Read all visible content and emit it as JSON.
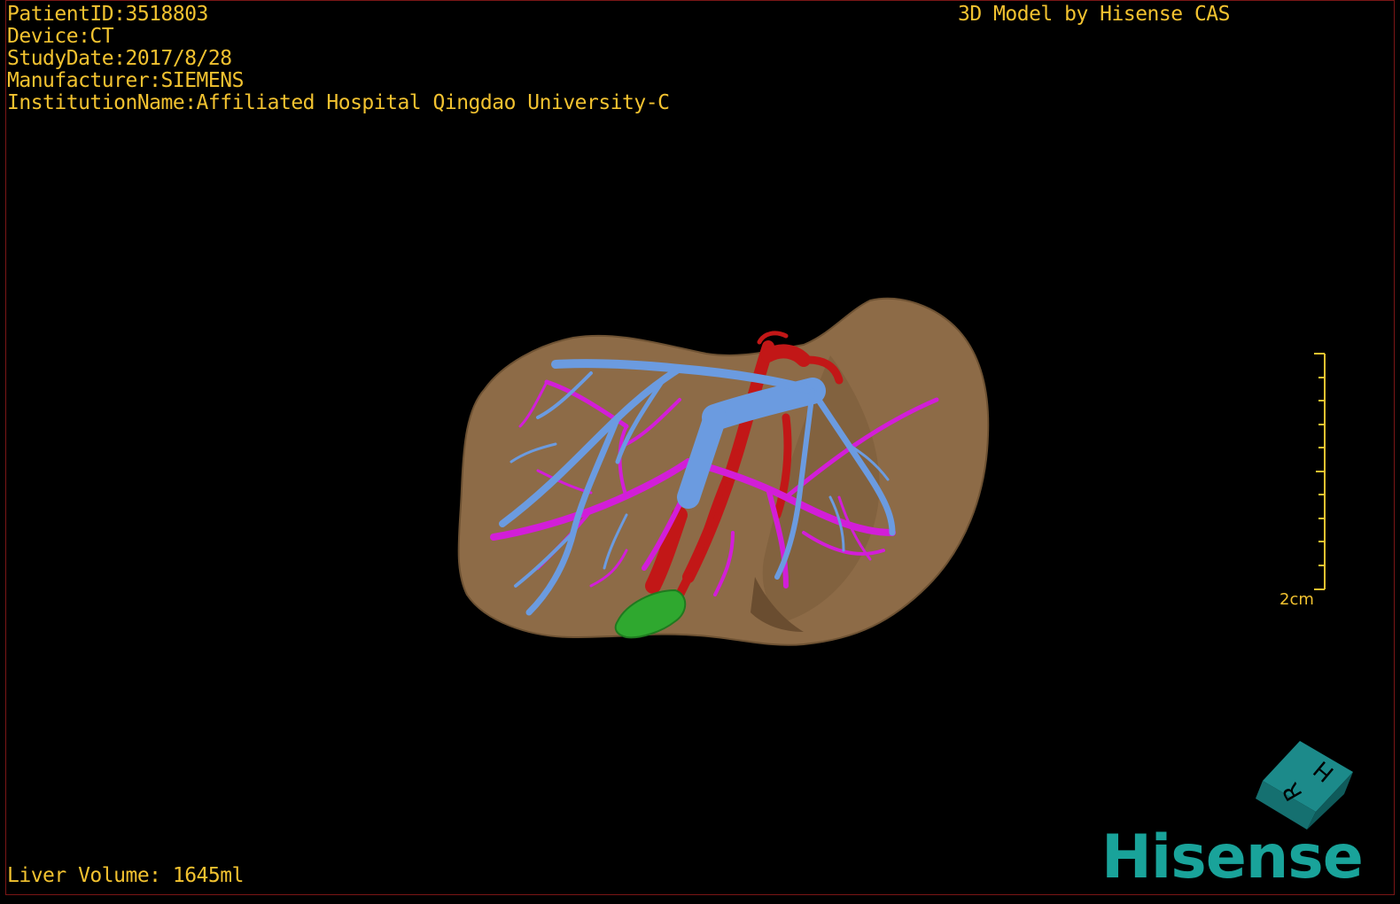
{
  "header": {
    "patient_id": "PatientID:3518803",
    "device": "Device:CT",
    "study_date": "StudyDate:2017/8/28",
    "manufacturer": "Manufacturer:SIEMENS",
    "institution": "InstitutionName:Affiliated Hospital Qingdao University-C"
  },
  "brand_caption": "3D Model by Hisense CAS",
  "footer": {
    "liver_volume": "Liver Volume: 1645ml"
  },
  "scale_bar": {
    "label": "2cm"
  },
  "orientation_cube": {
    "face_top": "H",
    "face_front": "R"
  },
  "logo": {
    "text": "Hisense"
  },
  "colors": {
    "text": "#f2c230",
    "liver": "#8d6b47",
    "portal_vein": "#6b9be0",
    "hepatic_vein": "#d21ed8",
    "artery": "#c21717",
    "gallbladder": "#2fa82f",
    "logo": "#19a39a"
  }
}
